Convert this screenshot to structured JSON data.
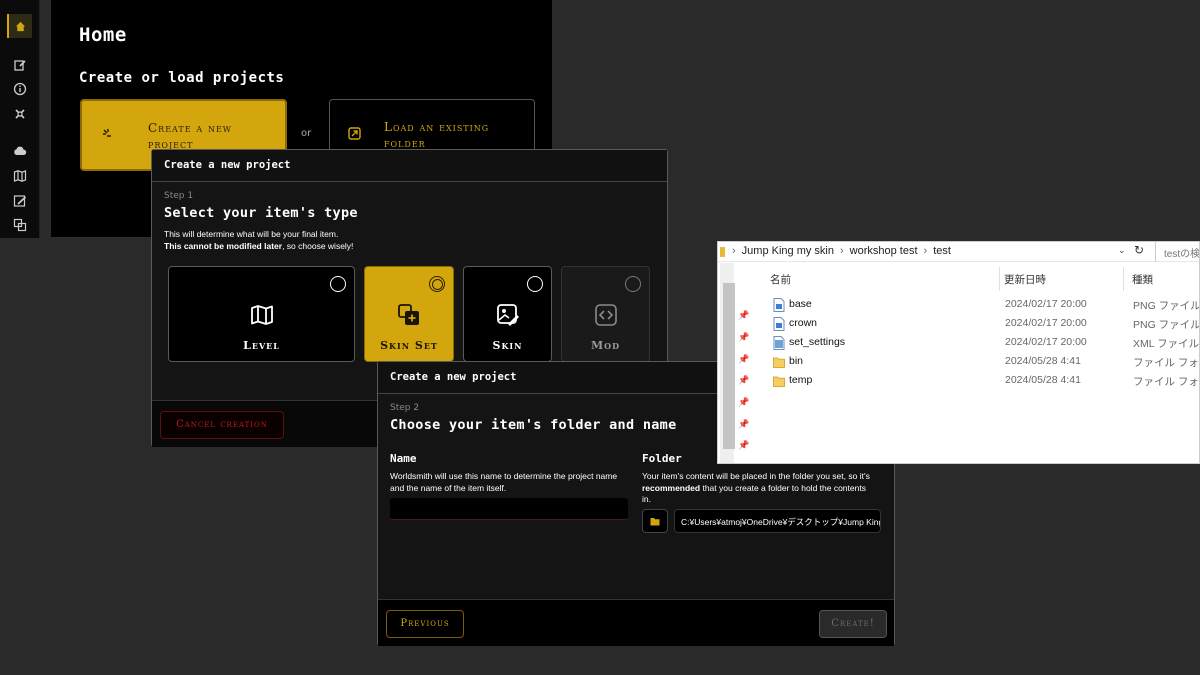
{
  "home": {
    "title": "Home",
    "subtitle": "Create or load projects",
    "create_label_1": "Create a new",
    "create_label_2": "project",
    "or_label": "or",
    "load_label_1": "Load an existing",
    "load_label_2": "folder"
  },
  "sidebar": {
    "accent": "#d4a60d",
    "items": [
      "home-icon",
      "edit-icon",
      "info-icon",
      "tools-icon",
      "cloud-icon",
      "map-icon",
      "edit-image-icon",
      "layers-icon"
    ]
  },
  "dialog1": {
    "header": "Create a new project",
    "step": "Step 1",
    "title": "Select your item's type",
    "desc_line1": "This will determine what will be your final item.",
    "desc_bold": "This cannot be modified later",
    "desc_rest": ", so choose wisely!",
    "types": [
      {
        "label": "Level",
        "icon": "map-icon",
        "state": "unselected"
      },
      {
        "label": "Skin Set",
        "icon": "skin-set-icon",
        "state": "selected"
      },
      {
        "label": "Skin",
        "icon": "skin-icon",
        "state": "unselected"
      },
      {
        "label": "Mod",
        "icon": "code-icon",
        "state": "disabled"
      }
    ],
    "cancel_label": "Cancel creation"
  },
  "dialog2": {
    "header": "Create a new project",
    "step": "Step 2",
    "title": "Choose your item's folder and name",
    "name_title": "Name",
    "name_desc_1": "Worldsmith will use this name to determine the project name",
    "name_desc_2": "and the name of the item itself.",
    "name_value": "",
    "folder_title": "Folder",
    "folder_desc_1": "Your item's content will be placed in the folder you set, so it's",
    "folder_desc_bold": "recommended",
    "folder_desc_2": " that you create a folder to hold the contents",
    "folder_desc_3": "in.",
    "folder_path": "C:¥Users¥atmoj¥OneDrive¥デスクトップ¥Jump King my skin¥workshop test¥test",
    "previous_label": "Previous",
    "create_label": "Create!"
  },
  "explorer": {
    "breadcrumb": [
      "Jump King my skin",
      "workshop test",
      "test"
    ],
    "search_placeholder": "testの検索",
    "columns": [
      "名前",
      "更新日時",
      "種類"
    ],
    "rows": [
      {
        "name": "base",
        "date": "2024/02/17 20:00",
        "type": "PNG ファイル",
        "icon": "png-file-icon"
      },
      {
        "name": "crown",
        "date": "2024/02/17 20:00",
        "type": "PNG ファイル",
        "icon": "png-file-icon"
      },
      {
        "name": "set_settings",
        "date": "2024/02/17 20:00",
        "type": "XML ファイル",
        "icon": "xml-file-icon"
      },
      {
        "name": "bin",
        "date": "2024/05/28 4:41",
        "type": "ファイル フォルダー",
        "icon": "folder-icon"
      },
      {
        "name": "temp",
        "date": "2024/05/28 4:41",
        "type": "ファイル フォルダー",
        "icon": "folder-icon"
      }
    ]
  }
}
